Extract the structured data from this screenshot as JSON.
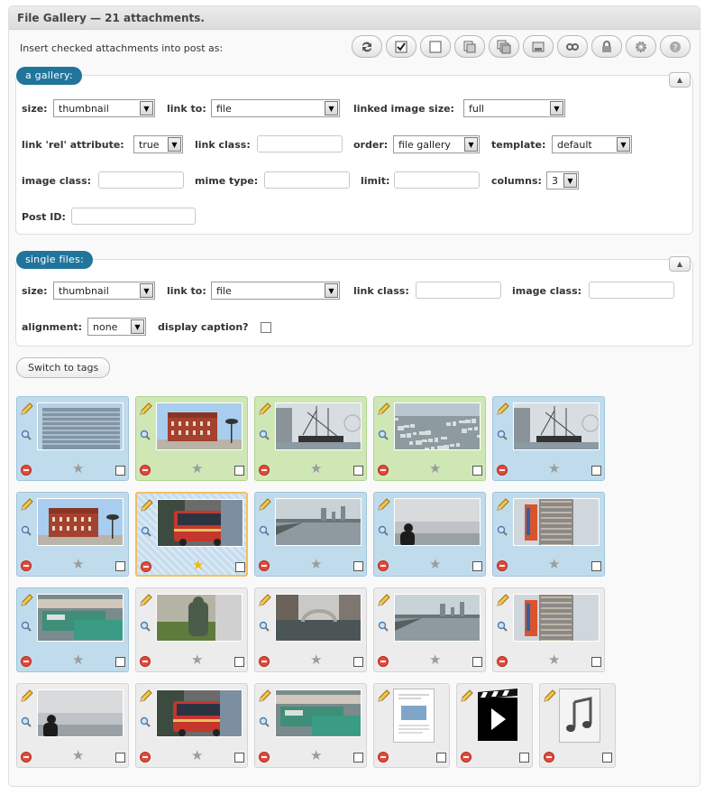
{
  "header": {
    "title": "File Gallery — 21 attachments."
  },
  "insert_label": "Insert checked attachments into post as:",
  "toolbar": [
    {
      "name": "refresh-icon"
    },
    {
      "name": "check-all-icon"
    },
    {
      "name": "uncheck-all-icon"
    },
    {
      "name": "copy-icon"
    },
    {
      "name": "copy-all-icon"
    },
    {
      "name": "insert-icon"
    },
    {
      "name": "detach-icon"
    },
    {
      "name": "lock-icon"
    },
    {
      "name": "settings-icon"
    },
    {
      "name": "help-icon"
    }
  ],
  "gallery": {
    "legend": "a gallery:",
    "size_label": "size:",
    "size_value": "thumbnail",
    "linkto_label": "link to:",
    "linkto_value": "file",
    "linked_size_label": "linked image size:",
    "linked_size_value": "full",
    "rel_label": "link 'rel' attribute:",
    "rel_value": "true",
    "linkclass_label": "link class:",
    "order_label": "order:",
    "order_value": "file gallery",
    "template_label": "template:",
    "template_value": "default",
    "imageclass_label": "image class:",
    "mime_label": "mime type:",
    "limit_label": "limit:",
    "columns_label": "columns:",
    "columns_value": "3",
    "postid_label": "Post ID:"
  },
  "single": {
    "legend": "single files:",
    "size_label": "size:",
    "size_value": "thumbnail",
    "linkto_label": "link to:",
    "linkto_value": "file",
    "linkclass_label": "link class:",
    "imageclass_label": "image class:",
    "align_label": "alignment:",
    "align_value": "none",
    "caption_label": "display caption?"
  },
  "switch_button": "Switch to tags",
  "attachments": [
    {
      "subject": "glass office building",
      "state": "blue"
    },
    {
      "subject": "red brick warehouse",
      "state": "green"
    },
    {
      "subject": "sailing ship at harbor",
      "state": "green"
    },
    {
      "subject": "city skyline aerial",
      "state": "green"
    },
    {
      "subject": "sailing ship at harbor",
      "state": "blue"
    },
    {
      "subject": "red brick warehouse",
      "state": "blue"
    },
    {
      "subject": "red tourist bus",
      "state": "selected",
      "starred": true
    },
    {
      "subject": "river and city",
      "state": "blue"
    },
    {
      "subject": "silhouette at dusk",
      "state": "blue"
    },
    {
      "subject": "tall building with banners",
      "state": "blue"
    },
    {
      "subject": "harbor boats",
      "state": "blue"
    },
    {
      "subject": "statue",
      "state": "grey"
    },
    {
      "subject": "canal with bridge",
      "state": "grey"
    },
    {
      "subject": "river and city",
      "state": "grey"
    },
    {
      "subject": "tall building with banners",
      "state": "grey"
    },
    {
      "subject": "silhouette at dusk",
      "state": "grey"
    },
    {
      "subject": "red tourist bus",
      "state": "grey"
    },
    {
      "subject": "harbor boats",
      "state": "grey"
    },
    {
      "subject": "document",
      "state": "grey",
      "kind": "document-icon"
    },
    {
      "subject": "video",
      "state": "grey",
      "kind": "video-icon"
    },
    {
      "subject": "audio",
      "state": "grey",
      "kind": "audio-icon"
    }
  ]
}
